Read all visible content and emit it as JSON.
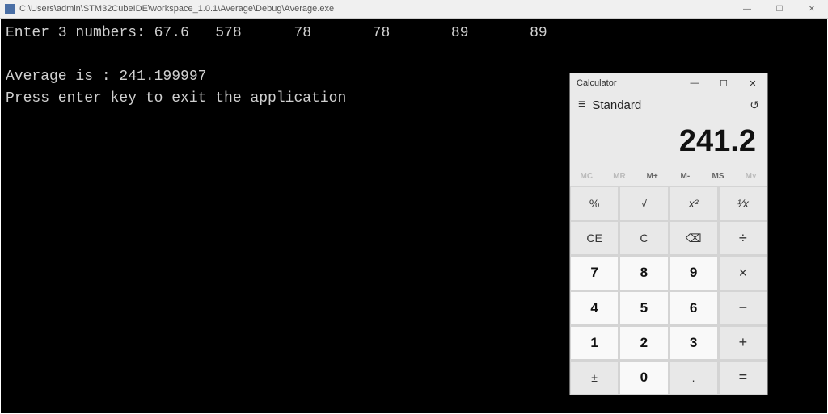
{
  "console": {
    "title": "C:\\Users\\admin\\STM32CubeIDE\\workspace_1.0.1\\Average\\Debug\\Average.exe",
    "lines": [
      "Enter 3 numbers: 67.6   578      78       78       89       89",
      "",
      "Average is : 241.199997",
      "Press enter key to exit the application"
    ],
    "win_controls": {
      "min": "—",
      "max": "☐",
      "close": "✕"
    }
  },
  "calculator": {
    "title": "Calculator",
    "win_controls": {
      "min": "—",
      "max": "☐",
      "close": "✕"
    },
    "mode": "Standard",
    "display": "241.2",
    "memory": [
      "MC",
      "MR",
      "M+",
      "M-",
      "MS",
      "M˅"
    ],
    "memory_disabled": [
      true,
      true,
      false,
      false,
      false,
      true
    ],
    "keys": [
      {
        "label": "%",
        "cls": "func",
        "name": "calc-key-percent"
      },
      {
        "label": "√",
        "cls": "func",
        "name": "calc-key-sqrt"
      },
      {
        "label": "x²",
        "cls": "func italic",
        "name": "calc-key-square"
      },
      {
        "label": "¹∕x",
        "cls": "func italic",
        "name": "calc-key-reciprocal"
      },
      {
        "label": "CE",
        "cls": "func",
        "name": "calc-key-ce"
      },
      {
        "label": "C",
        "cls": "func",
        "name": "calc-key-c"
      },
      {
        "label": "⌫",
        "cls": "func",
        "name": "calc-key-backspace"
      },
      {
        "label": "÷",
        "cls": "op",
        "name": "calc-key-divide"
      },
      {
        "label": "7",
        "cls": "digit",
        "name": "calc-key-7"
      },
      {
        "label": "8",
        "cls": "digit",
        "name": "calc-key-8"
      },
      {
        "label": "9",
        "cls": "digit",
        "name": "calc-key-9"
      },
      {
        "label": "×",
        "cls": "op",
        "name": "calc-key-multiply"
      },
      {
        "label": "4",
        "cls": "digit",
        "name": "calc-key-4"
      },
      {
        "label": "5",
        "cls": "digit",
        "name": "calc-key-5"
      },
      {
        "label": "6",
        "cls": "digit",
        "name": "calc-key-6"
      },
      {
        "label": "−",
        "cls": "op",
        "name": "calc-key-minus"
      },
      {
        "label": "1",
        "cls": "digit",
        "name": "calc-key-1"
      },
      {
        "label": "2",
        "cls": "digit",
        "name": "calc-key-2"
      },
      {
        "label": "3",
        "cls": "digit",
        "name": "calc-key-3"
      },
      {
        "label": "+",
        "cls": "op",
        "name": "calc-key-plus"
      },
      {
        "label": "±",
        "cls": "func",
        "name": "calc-key-negate"
      },
      {
        "label": "0",
        "cls": "digit",
        "name": "calc-key-0"
      },
      {
        "label": ".",
        "cls": "func",
        "name": "calc-key-decimal"
      },
      {
        "label": "=",
        "cls": "op",
        "name": "calc-key-equals"
      }
    ]
  }
}
